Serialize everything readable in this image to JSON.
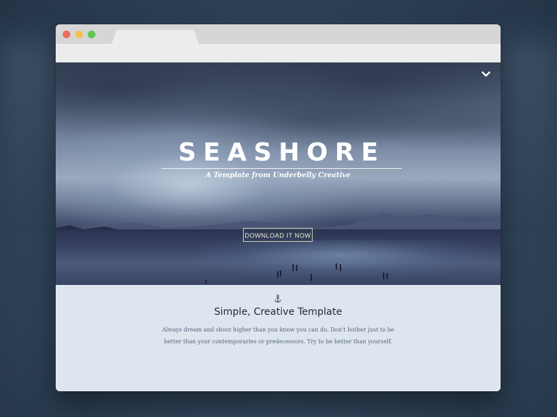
{
  "window": {
    "traffic_lights": {
      "red": "#ed6b5f",
      "yellow": "#f5bf4f",
      "green": "#61c554"
    }
  },
  "hero": {
    "title": "SEASHORE",
    "subtitle": "A Template from Underbelly Creative",
    "cta_label": "DOWNLOAD IT NOW",
    "scroll_icon": "chevron-down-icon"
  },
  "content": {
    "icon": "anchor-icon",
    "title": "Simple, Creative Template",
    "body": "Always dream and shoot higher than you know you can do. Don't bother just to be better than your contemporaries or predecessors. Try to be better than yourself."
  },
  "colors": {
    "content_bg": "#dde6ee",
    "title_color": "#22293a",
    "body_color": "#56637d"
  }
}
